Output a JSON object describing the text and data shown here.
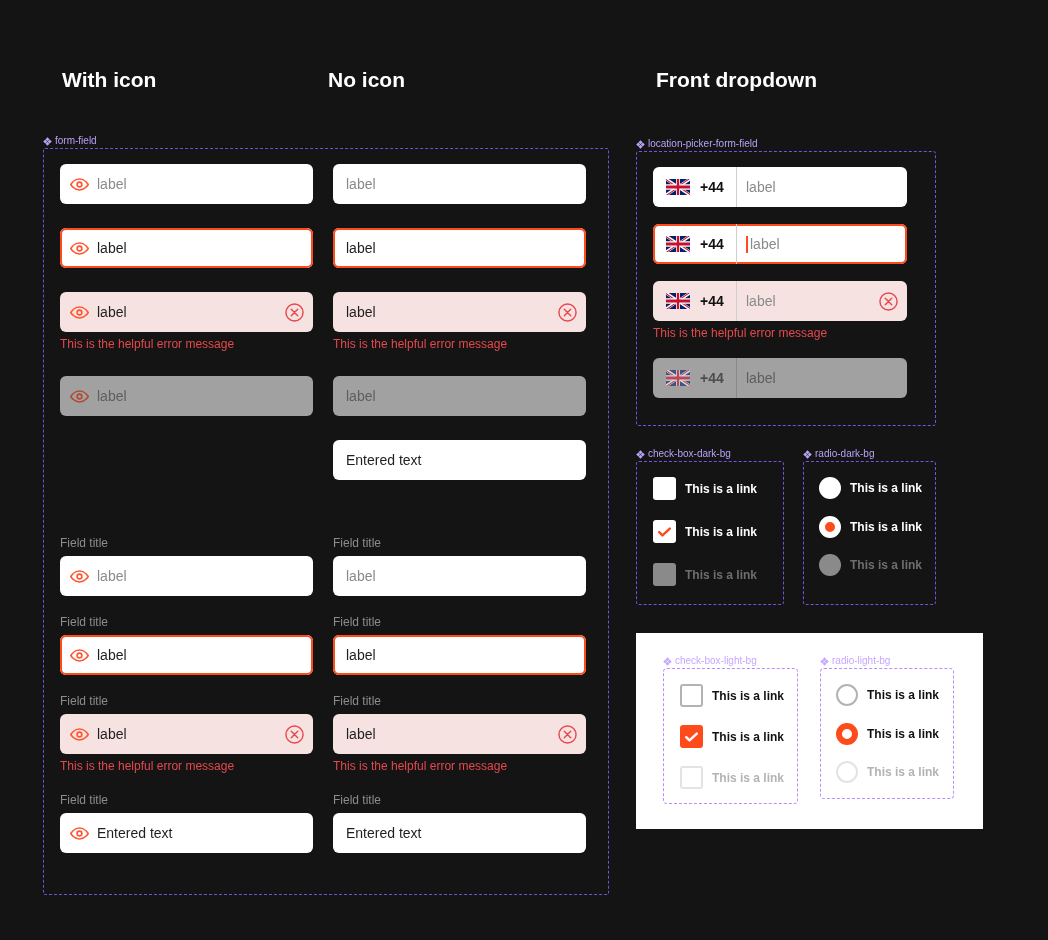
{
  "form_field": {
    "frame_label": "form-field",
    "columns": [
      {
        "heading": "With icon",
        "icon": true,
        "fields": [
          {
            "placeholder": "label",
            "focused": false,
            "error": false,
            "disabled": false
          },
          {
            "value": "label",
            "focused": true,
            "error": false,
            "disabled": false
          },
          {
            "value": "label",
            "focused": false,
            "error": true,
            "disabled": false,
            "error_message": "This is the helpful error message"
          },
          {
            "placeholder": "label",
            "focused": false,
            "error": false,
            "disabled": true
          },
          {
            "title": "Field title",
            "placeholder": "label",
            "focused": false,
            "error": false,
            "disabled": false
          },
          {
            "title": "Field title",
            "value": "label",
            "focused": true,
            "error": false,
            "disabled": false
          },
          {
            "title": "Field title",
            "value": "label",
            "focused": false,
            "error": true,
            "disabled": false,
            "error_message": "This is the helpful error message"
          },
          {
            "title": "Field title",
            "value": "Entered text",
            "focused": false,
            "error": false,
            "disabled": false
          }
        ]
      },
      {
        "heading": "No icon",
        "icon": false,
        "fields": [
          {
            "placeholder": "label",
            "focused": false,
            "error": false,
            "disabled": false
          },
          {
            "value": "label",
            "focused": true,
            "error": false,
            "disabled": false
          },
          {
            "value": "label",
            "focused": false,
            "error": true,
            "disabled": false,
            "error_message": "This is the helpful error message"
          },
          {
            "placeholder": "label",
            "focused": false,
            "error": false,
            "disabled": true
          },
          {
            "value": "Entered text",
            "focused": false,
            "error": false,
            "disabled": false
          },
          {
            "title": "Field title",
            "placeholder": "label",
            "focused": false,
            "error": false,
            "disabled": false
          },
          {
            "title": "Field title",
            "value": "label",
            "focused": true,
            "error": false,
            "disabled": false
          },
          {
            "title": "Field title",
            "value": "label",
            "focused": false,
            "error": true,
            "disabled": false,
            "error_message": "This is the helpful error message"
          },
          {
            "title": "Field title",
            "value": "Entered text",
            "focused": false,
            "error": false,
            "disabled": false
          }
        ]
      }
    ]
  },
  "front_dropdown": {
    "heading": "Front dropdown",
    "location_picker": {
      "frame_label": "location-picker-form-field",
      "fields": [
        {
          "country_code": "+44",
          "placeholder": "label",
          "focused": false,
          "error": false,
          "disabled": false
        },
        {
          "country_code": "+44",
          "placeholder": "label",
          "focused": true,
          "error": false,
          "disabled": false
        },
        {
          "country_code": "+44",
          "placeholder": "label",
          "focused": false,
          "error": true,
          "disabled": false,
          "error_message": "This is the helpful error message"
        },
        {
          "country_code": "+44",
          "placeholder": "label",
          "focused": false,
          "error": false,
          "disabled": true
        }
      ]
    },
    "check_box_dark_bg": {
      "frame_label": "check-box-dark-bg",
      "items": [
        {
          "label": "This is a link",
          "checked": false,
          "disabled": false
        },
        {
          "label": "This is a link",
          "checked": true,
          "disabled": false
        },
        {
          "label": "This is a link",
          "checked": false,
          "disabled": true
        }
      ]
    },
    "radio_dark_bg": {
      "frame_label": "radio-dark-bg",
      "items": [
        {
          "label": "This is a link",
          "selected": false,
          "disabled": false
        },
        {
          "label": "This is a link",
          "selected": true,
          "disabled": false
        },
        {
          "label": "This is a link",
          "selected": false,
          "disabled": true
        }
      ]
    },
    "light_panel": {
      "check_box_light_bg": {
        "frame_label": "check-box-light-bg",
        "items": [
          {
            "label": "This is a link",
            "checked": false,
            "disabled": false
          },
          {
            "label": "This is a link",
            "checked": true,
            "disabled": false
          },
          {
            "label": "This is a link",
            "checked": false,
            "disabled": true
          }
        ]
      },
      "radio_light_bg": {
        "frame_label": "radio-light-bg",
        "items": [
          {
            "label": "This is a link",
            "selected": false,
            "disabled": false
          },
          {
            "label": "This is a link",
            "selected": true,
            "disabled": false
          },
          {
            "label": "This is a link",
            "selected": false,
            "disabled": true
          }
        ]
      }
    }
  }
}
